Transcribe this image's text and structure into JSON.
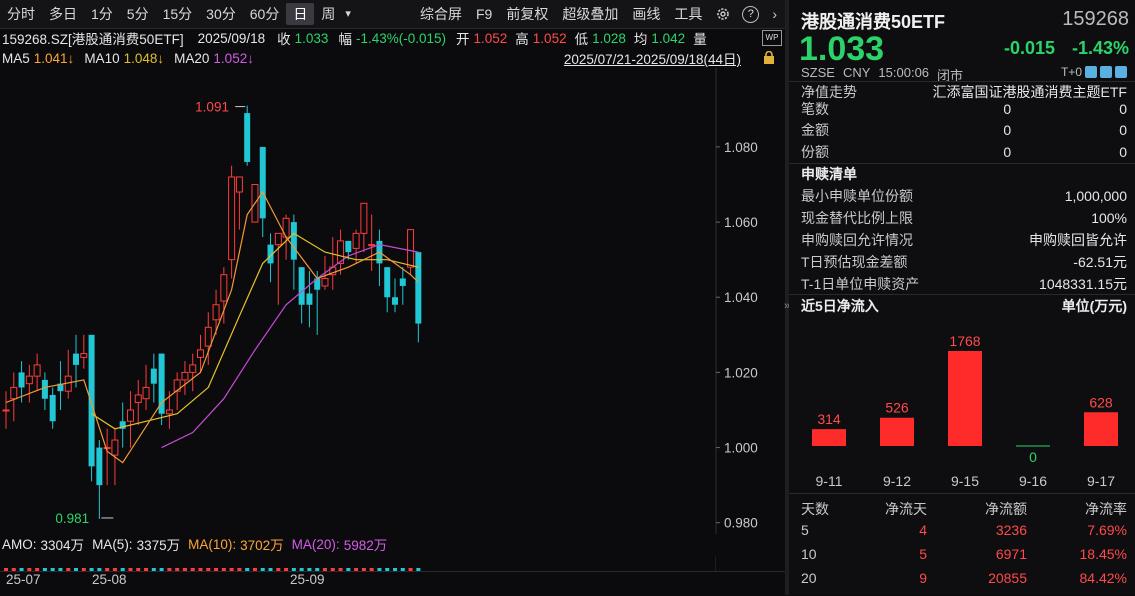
{
  "toolbar": {
    "periods": [
      "分时",
      "多日",
      "1分",
      "5分",
      "15分",
      "30分",
      "60分",
      "日",
      "周"
    ],
    "active_period": "日",
    "dropdown_glyph": "▾",
    "tools": [
      "综合屏",
      "F9",
      "前复权",
      "超级叠加",
      "画线",
      "工具"
    ],
    "icons": [
      "settings-icon",
      "help-icon",
      "chevron-right-icon"
    ]
  },
  "quote_line": {
    "code_name": "159268.SZ[港股通消费50ETF]",
    "date": "2025/09/18",
    "close_label": "收",
    "close": "1.033",
    "change_label": "幅",
    "change": "-1.43%(-0.015)",
    "open_label": "开",
    "open": "1.052",
    "high_label": "高",
    "high": "1.052",
    "low_label": "低",
    "low": "1.028",
    "avg_label": "均",
    "avg": "1.042",
    "vol_label": "量"
  },
  "ma_line": {
    "ma5_label": "MA5",
    "ma5": "1.041↓",
    "ma10_label": "MA10",
    "ma10": "1.048↓",
    "ma20_label": "MA20",
    "ma20": "1.052↓",
    "range": "2025/07/21-2025/09/18(44日)"
  },
  "chart_data": {
    "type": "candlestick",
    "y_ticks": [
      "1.080",
      "1.060",
      "1.040",
      "1.020",
      "1.000",
      "0.980"
    ],
    "ylim": [
      0.977,
      1.101
    ],
    "annotations": {
      "max": "1.091",
      "min": "0.981"
    },
    "x_labels": [
      "25-07",
      "25-08",
      "25-09"
    ],
    "candles": [
      [
        1.01,
        1.01,
        1.015,
        1.005
      ],
      [
        1.013,
        1.016,
        1.02,
        1.007
      ],
      [
        1.02,
        1.016,
        1.023,
        1.012
      ],
      [
        1.017,
        1.019,
        1.022,
        1.012
      ],
      [
        1.019,
        1.022,
        1.025,
        1.015
      ],
      [
        1.018,
        1.013,
        1.02,
        1.01
      ],
      [
        1.014,
        1.007,
        1.016,
        1.005
      ],
      [
        1.017,
        1.015,
        1.023,
        1.01
      ],
      [
        1.015,
        1.019,
        1.026,
        1.013
      ],
      [
        1.025,
        1.022,
        1.03,
        1.016
      ],
      [
        1.024,
        1.025,
        1.03,
        1.021
      ],
      [
        1.03,
        0.995,
        1.03,
        0.991
      ],
      [
        1.0,
        0.99,
        1.002,
        0.981
      ],
      [
        1.0,
        1.0,
        1.005,
        0.99
      ],
      [
        0.998,
        1.002,
        1.005,
        0.99
      ],
      [
        1.007,
        1.005,
        1.012,
        1.0
      ],
      [
        1.007,
        1.01,
        1.015,
        1.0
      ],
      [
        1.012,
        1.014,
        1.018,
        1.006
      ],
      [
        1.013,
        1.016,
        1.022,
        1.01
      ],
      [
        1.021,
        1.017,
        1.025,
        1.012
      ],
      [
        1.025,
        1.009,
        1.025,
        1.006
      ],
      [
        1.009,
        1.01,
        1.015,
        1.005
      ],
      [
        1.015,
        1.018,
        1.02,
        1.01
      ],
      [
        1.018,
        1.02,
        1.023,
        1.014
      ],
      [
        1.02,
        1.022,
        1.025,
        1.015
      ],
      [
        1.024,
        1.026,
        1.03,
        1.02
      ],
      [
        1.027,
        1.032,
        1.036,
        1.022
      ],
      [
        1.034,
        1.038,
        1.042,
        1.03
      ],
      [
        1.039,
        1.046,
        1.048,
        1.033
      ],
      [
        1.05,
        1.072,
        1.075,
        1.045
      ],
      [
        1.068,
        1.072,
        1.072,
        1.058
      ],
      [
        1.089,
        1.076,
        1.091,
        1.075
      ],
      [
        1.06,
        1.07,
        1.07,
        1.06
      ],
      [
        1.08,
        1.061,
        1.08,
        1.056
      ],
      [
        1.054,
        1.049,
        1.057,
        1.044
      ],
      [
        1.054,
        1.057,
        1.057,
        1.038
      ],
      [
        1.056,
        1.061,
        1.062,
        1.05
      ],
      [
        1.06,
        1.05,
        1.062,
        1.042
      ],
      [
        1.048,
        1.038,
        1.048,
        1.033
      ],
      [
        1.041,
        1.038,
        1.047,
        1.032
      ],
      [
        1.045,
        1.042,
        1.047,
        1.03
      ],
      [
        1.043,
        1.045,
        1.051,
        1.042
      ],
      [
        1.046,
        1.048,
        1.056,
        1.042
      ],
      [
        1.049,
        1.055,
        1.058,
        1.046
      ],
      [
        1.055,
        1.052,
        1.055,
        1.05
      ],
      [
        1.053,
        1.057,
        1.058,
        1.049
      ],
      [
        1.057,
        1.065,
        1.065,
        1.052
      ],
      [
        1.054,
        1.054,
        1.062,
        1.047
      ],
      [
        1.055,
        1.049,
        1.058,
        1.043
      ],
      [
        1.048,
        1.04,
        1.048,
        1.036
      ],
      [
        1.04,
        1.038,
        1.045,
        1.036
      ],
      [
        1.045,
        1.043,
        1.048,
        1.038
      ],
      [
        1.048,
        1.058,
        1.058,
        1.046
      ],
      [
        1.052,
        1.033,
        1.052,
        1.028
      ]
    ],
    "ma5": [
      [
        0,
        1.012
      ],
      [
        5,
        1.016
      ],
      [
        10,
        1.018
      ],
      [
        13,
        0.999
      ],
      [
        15,
        0.996
      ],
      [
        20,
        1.012
      ],
      [
        25,
        1.02
      ],
      [
        29,
        1.042
      ],
      [
        31,
        1.062
      ],
      [
        33,
        1.068
      ],
      [
        36,
        1.056
      ],
      [
        40,
        1.045
      ],
      [
        44,
        1.048
      ],
      [
        48,
        1.052
      ],
      [
        52,
        1.046
      ],
      [
        53,
        1.044
      ]
    ],
    "ma10": [
      [
        11,
        1.009
      ],
      [
        14,
        1.005
      ],
      [
        18,
        1.007
      ],
      [
        22,
        1.009
      ],
      [
        26,
        1.016
      ],
      [
        30,
        1.035
      ],
      [
        33,
        1.049
      ],
      [
        37,
        1.057
      ],
      [
        41,
        1.052
      ],
      [
        45,
        1.05
      ],
      [
        49,
        1.05
      ],
      [
        53,
        1.048
      ]
    ],
    "ma20": [
      [
        20,
        1.0
      ],
      [
        24,
        1.004
      ],
      [
        28,
        1.013
      ],
      [
        32,
        1.026
      ],
      [
        36,
        1.038
      ],
      [
        40,
        1.045
      ],
      [
        44,
        1.051
      ],
      [
        48,
        1.054
      ],
      [
        53,
        1.052
      ]
    ]
  },
  "amo_line": {
    "amo_label": "AMO:",
    "amo": "3304万",
    "ma5_label": "MA(5):",
    "ma5": "3375万",
    "ma10_label": "MA(10):",
    "ma10": "3702万",
    "ma20_label": "MA(20):",
    "ma20": "5982万"
  },
  "panel": {
    "title": "港股通消费50ETF",
    "code": "159268",
    "price": "1.033",
    "change": "-0.015",
    "change_pct": "-1.43%",
    "market": "SZSE",
    "currency": "CNY",
    "time": "15:00:06",
    "status": "闭市",
    "t0": "T+0",
    "nav_label": "净值走势",
    "nav_name": "汇添富国证港股通消费主题ETF",
    "stats": [
      {
        "label": "笔数",
        "a": "0",
        "b": "0"
      },
      {
        "label": "金额",
        "a": "0",
        "b": "0"
      },
      {
        "label": "份额",
        "a": "0",
        "b": "0"
      }
    ],
    "sub_title": "申赎清单",
    "sub_rows": [
      {
        "label": "最小申赎单位份额",
        "value": "1,000,000"
      },
      {
        "label": "现金替代比例上限",
        "value": "100%"
      },
      {
        "label": "申购赎回允许情况",
        "value": "申购赎回皆允许"
      },
      {
        "label": "T日预估现金差额",
        "value": "-62.51元"
      },
      {
        "label": "T-1日单位申赎资产",
        "value": "1048331.15元"
      }
    ],
    "flow_title": "近5日净流入",
    "flow_unit": "单位(万元)",
    "flow_data": {
      "type": "bar",
      "categories": [
        "9-11",
        "9-12",
        "9-15",
        "9-16",
        "9-17"
      ],
      "values": [
        314,
        526,
        1768,
        0,
        628
      ]
    },
    "table_headers": [
      "天数",
      "净流天",
      "净流额",
      "净流率"
    ],
    "table_rows": [
      [
        "5",
        "4",
        "3236",
        "7.69%"
      ],
      [
        "10",
        "5",
        "6971",
        "18.45%"
      ],
      [
        "20",
        "9",
        "20855",
        "84.42%"
      ]
    ],
    "colors": {
      "up": "#ff3b3b",
      "down": "#21c7d4",
      "green": "#2bd46b"
    }
  }
}
